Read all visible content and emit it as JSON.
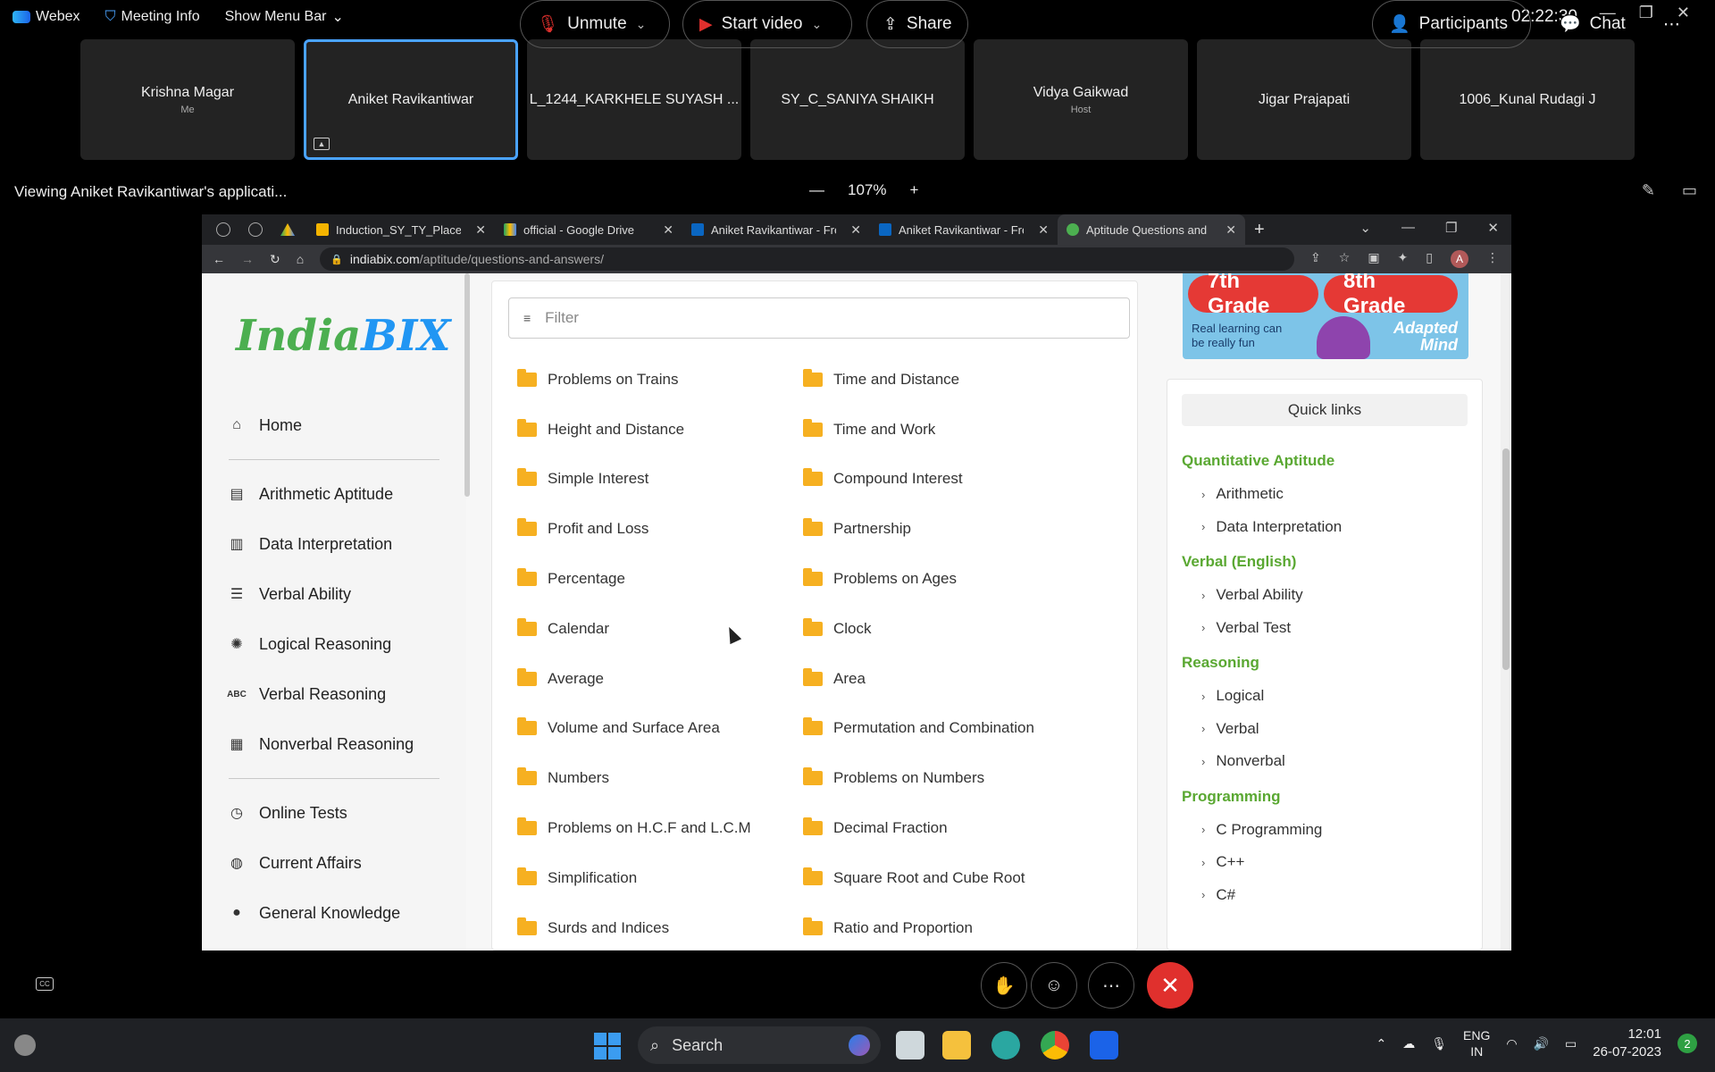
{
  "webex": {
    "app_name": "Webex",
    "meeting_info": "Meeting Info",
    "show_menu_bar": "Show Menu Bar",
    "timer": "02:22:30",
    "participants": [
      {
        "name": "Krishna Magar",
        "role": "Me"
      },
      {
        "name": "Aniket Ravikantiwar",
        "role": ""
      },
      {
        "name": "L_1244_KARKHELE SUYASH ...",
        "role": ""
      },
      {
        "name": "SY_C_SANIYA SHAIKH",
        "role": ""
      },
      {
        "name": "Vidya Gaikwad",
        "role": "Host"
      },
      {
        "name": "Jigar Prajapati",
        "role": ""
      },
      {
        "name": "1006_Kunal Rudagi J",
        "role": ""
      }
    ],
    "viewing": "Viewing Aniket Ravikantiwar's applicati...",
    "zoom": "107%",
    "controls": {
      "unmute": "Unmute",
      "start_video": "Start video",
      "share": "Share",
      "participants": "Participants",
      "chat": "Chat"
    }
  },
  "browser": {
    "tabs": [
      "Induction_SY_TY_Placem",
      "official - Google Drive",
      "Aniket Ravikantiwar - Fre",
      "Aniket Ravikantiwar - Fre",
      "Aptitude Questions and"
    ],
    "url_host": "indiabix.com",
    "url_path": "/aptitude/questions-and-answers/",
    "avatar_letter": "A"
  },
  "site": {
    "logo_part1": "India",
    "logo_part2": "BIX",
    "nav_primary": [
      "Home"
    ],
    "nav_sections": [
      "Arithmetic Aptitude",
      "Data Interpretation",
      "Verbal Ability",
      "Logical Reasoning",
      "Verbal Reasoning",
      "Nonverbal Reasoning"
    ],
    "nav_more": [
      "Online Tests",
      "Current Affairs",
      "General Knowledge"
    ],
    "filter_placeholder": "Filter",
    "topics_left": [
      "Problems on Trains",
      "Height and Distance",
      "Simple Interest",
      "Profit and Loss",
      "Percentage",
      "Calendar",
      "Average",
      "Volume and Surface Area",
      "Numbers",
      "Problems on H.C.F and L.C.M",
      "Simplification",
      "Surds and Indices"
    ],
    "topics_right": [
      "Time and Distance",
      "Time and Work",
      "Compound Interest",
      "Partnership",
      "Problems on Ages",
      "Clock",
      "Area",
      "Permutation and Combination",
      "Problems on Numbers",
      "Decimal Fraction",
      "Square Root and Cube Root",
      "Ratio and Proportion"
    ],
    "ad": {
      "pill1": "7th Grade",
      "pill2": "8th Grade",
      "tagline_1": "Real learning can",
      "tagline_2": "be really fun",
      "brand_1": "Adapted",
      "brand_2": "Mind"
    },
    "quick_links_title": "Quick links",
    "quick_links": [
      {
        "category": "Quantitative Aptitude",
        "items": [
          "Arithmetic",
          "Data Interpretation"
        ]
      },
      {
        "category": "Verbal (English)",
        "items": [
          "Verbal Ability",
          "Verbal Test"
        ]
      },
      {
        "category": "Reasoning",
        "items": [
          "Logical",
          "Verbal",
          "Nonverbal"
        ]
      },
      {
        "category": "Programming",
        "items": [
          "C Programming",
          "C++",
          "C#"
        ]
      }
    ]
  },
  "taskbar": {
    "search": "Search",
    "lang_1": "ENG",
    "lang_2": "IN",
    "time": "12:01",
    "date": "26-07-2023",
    "notifications": "2"
  }
}
